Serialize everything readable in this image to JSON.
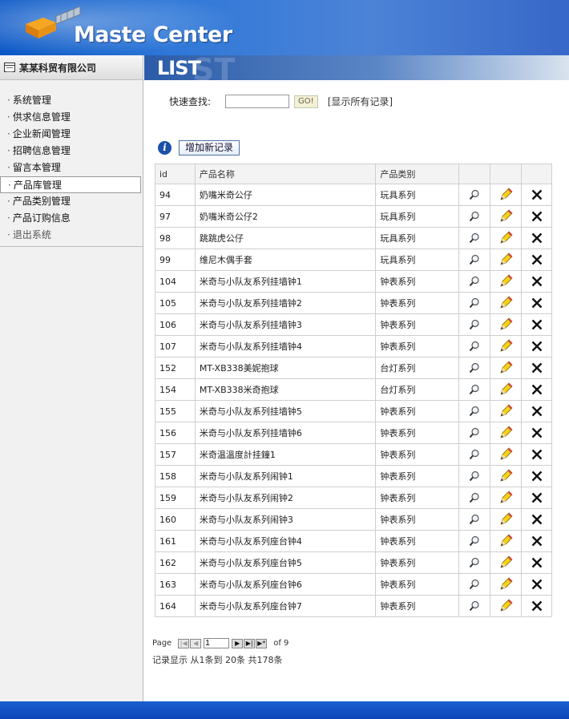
{
  "header": {
    "brand": "Maste Center"
  },
  "sidebar": {
    "company": "某某科贸有限公司",
    "items": [
      {
        "label": "系统管理"
      },
      {
        "label": "供求信息管理"
      },
      {
        "label": "企业新闻管理"
      },
      {
        "label": "招聘信息管理"
      },
      {
        "label": "留言本管理"
      },
      {
        "label": "产品库管理"
      },
      {
        "label": "产品类别管理"
      },
      {
        "label": "产品订购信息"
      },
      {
        "label": "退出系统"
      }
    ]
  },
  "banner": {
    "title": "LIST",
    "ghost": "ST"
  },
  "search": {
    "label": "快速查找:",
    "value": "",
    "go": "GO!",
    "show_all": "[显示所有记录]"
  },
  "add_button": "增加新记录",
  "table": {
    "headers": [
      "id",
      "产品名称",
      "产品类别",
      "",
      "",
      ""
    ],
    "rows": [
      {
        "id": "94",
        "name": "奶嘴米奇公仔",
        "cat": "玩具系列"
      },
      {
        "id": "97",
        "name": "奶嘴米奇公仔2",
        "cat": "玩具系列"
      },
      {
        "id": "98",
        "name": "跳跳虎公仔",
        "cat": "玩具系列"
      },
      {
        "id": "99",
        "name": "维尼木偶手套",
        "cat": "玩具系列"
      },
      {
        "id": "104",
        "name": "米奇与小队友系列挂墙钟1",
        "cat": "钟表系列"
      },
      {
        "id": "105",
        "name": "米奇与小队友系列挂墙钟2",
        "cat": "钟表系列"
      },
      {
        "id": "106",
        "name": "米奇与小队友系列挂墙钟3",
        "cat": "钟表系列"
      },
      {
        "id": "107",
        "name": "米奇与小队友系列挂墙钟4",
        "cat": "钟表系列"
      },
      {
        "id": "152",
        "name": "MT-XB338美妮抱球",
        "cat": "台灯系列"
      },
      {
        "id": "154",
        "name": "MT-XB338米奇抱球",
        "cat": "台灯系列"
      },
      {
        "id": "155",
        "name": "米奇与小队友系列挂墙钟5",
        "cat": "钟表系列"
      },
      {
        "id": "156",
        "name": "米奇与小队友系列挂墙钟6",
        "cat": "钟表系列"
      },
      {
        "id": "157",
        "name": "米奇温溫度計挂鐘1",
        "cat": "钟表系列"
      },
      {
        "id": "158",
        "name": "米奇与小队友系列闹钟1",
        "cat": "钟表系列"
      },
      {
        "id": "159",
        "name": "米奇与小队友系列闹钟2",
        "cat": "钟表系列"
      },
      {
        "id": "160",
        "name": "米奇与小队友系列闹钟3",
        "cat": "钟表系列"
      },
      {
        "id": "161",
        "name": "米奇与小队友系列座台钟4",
        "cat": "钟表系列"
      },
      {
        "id": "162",
        "name": "米奇与小队友系列座台钟5",
        "cat": "钟表系列"
      },
      {
        "id": "163",
        "name": "米奇与小队友系列座台钟6",
        "cat": "钟表系列"
      },
      {
        "id": "164",
        "name": "米奇与小队友系列座台钟7",
        "cat": "钟表系列"
      }
    ]
  },
  "pager": {
    "page_label": "Page",
    "page_value": "1",
    "of_label": "of 9"
  },
  "summary": "记录显示 从1条到 20条 共178条",
  "icons": {
    "view": "magnifier-icon",
    "edit": "pencil-icon",
    "delete": "close-x-icon"
  }
}
